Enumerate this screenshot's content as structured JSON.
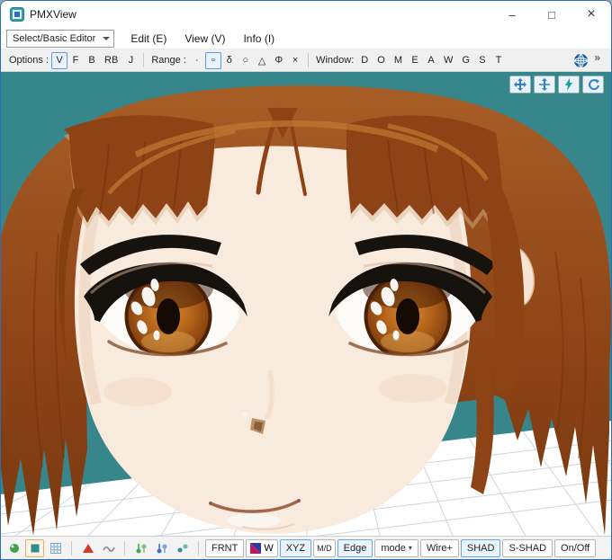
{
  "window": {
    "title": "PMXView",
    "controls": {
      "minimize": "–",
      "maximize": "□",
      "close": "×"
    }
  },
  "menu": {
    "selector": "Select/Basic Editor",
    "items": [
      {
        "label": "Edit (E)"
      },
      {
        "label": "View (V)"
      },
      {
        "label": "Info (I)"
      }
    ]
  },
  "toolbar": {
    "options_label": "Options :",
    "options_buttons": [
      {
        "label": "V",
        "active": true
      },
      {
        "label": "F"
      },
      {
        "label": "B"
      },
      {
        "label": "RB"
      },
      {
        "label": "J"
      }
    ],
    "range_label": "Range :",
    "range_buttons": [
      {
        "label": "·"
      },
      {
        "label": "▫",
        "active": true
      },
      {
        "label": "δ"
      },
      {
        "label": "○"
      },
      {
        "label": "△"
      },
      {
        "label": "Φ"
      },
      {
        "label": "×"
      }
    ],
    "window_label": "Window:",
    "window_buttons": [
      "D",
      "O",
      "M",
      "E",
      "A",
      "W",
      "G",
      "S",
      "T"
    ],
    "overflow": "»"
  },
  "viewport": {
    "background": "#37868C",
    "model": {
      "hair_color": "#9A5320",
      "bangs_color": "#8E4316",
      "skin_color": "#F8EBDE",
      "eye_color": "#B4641A",
      "grid_color": "#FFFFFF"
    }
  },
  "statusbar": {
    "front": "FRNT",
    "w": "W",
    "xyz": "XYZ",
    "md": "M/D",
    "edge": "Edge",
    "mode": "mode",
    "mode_caret": "▾",
    "wire": "Wire+",
    "shad": "SHAD",
    "sshad": "S-SHAD",
    "onoff": "On/Off"
  }
}
